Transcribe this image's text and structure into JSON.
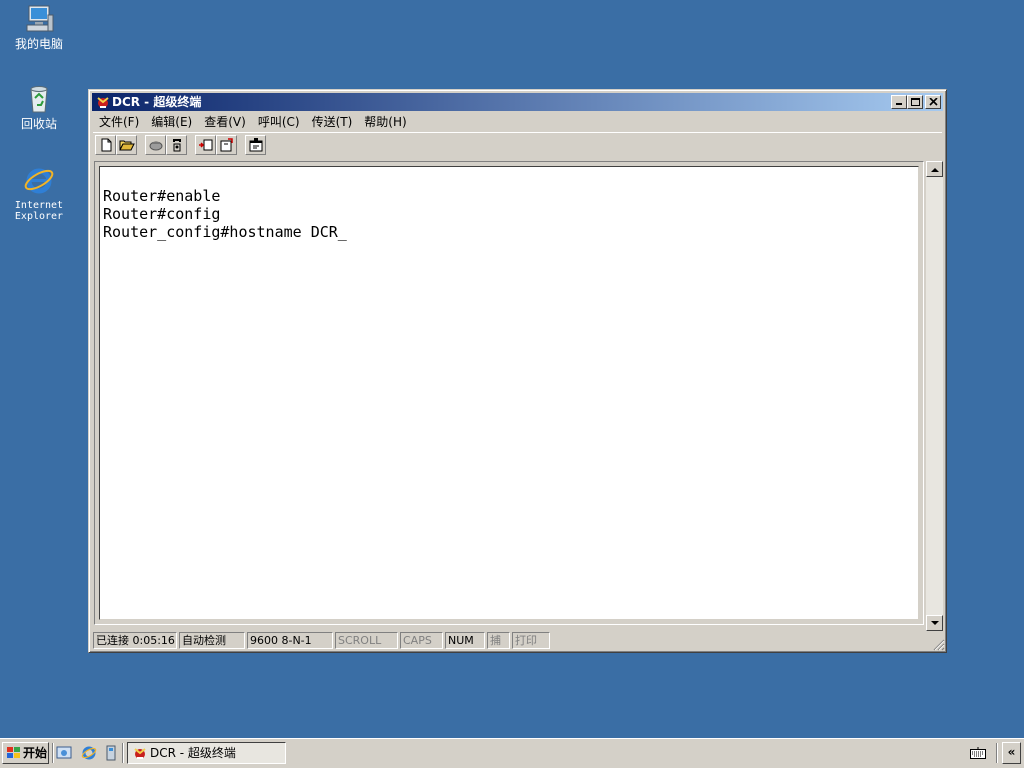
{
  "desktop": {
    "icons": [
      {
        "label": "我的电脑",
        "icon": "computer-icon"
      },
      {
        "label": "回收站",
        "icon": "recycle-bin-icon"
      },
      {
        "label_line1": "Internet",
        "label_line2": "Explorer",
        "icon": "ie-icon"
      }
    ]
  },
  "window": {
    "title": "DCR - 超级终端",
    "menus": [
      "文件(F)",
      "编辑(E)",
      "查看(V)",
      "呼叫(C)",
      "传送(T)",
      "帮助(H)"
    ],
    "toolbar": [
      "new-icon",
      "open-icon",
      "disconnect-icon",
      "call-icon",
      "send-icon",
      "receive-icon",
      "properties-icon"
    ],
    "terminal_lines": [
      "Router#enable",
      "Router#config",
      "Router_config#hostname DCR_"
    ],
    "status": {
      "connected": "已连接 0:05:16",
      "detect": "自动检测",
      "port": "9600 8-N-1",
      "scroll": "SCROLL",
      "caps": "CAPS",
      "num": "NUM",
      "capture": "捕",
      "print": "打印"
    }
  },
  "taskbar": {
    "start_label": "开始",
    "task_title": "DCR - 超级终端",
    "tray_arrow": "«"
  },
  "colors": {
    "desktop": "#3a6ea5",
    "title_start": "#0a246a",
    "title_end": "#a6caf0",
    "face": "#d4d0c8"
  }
}
